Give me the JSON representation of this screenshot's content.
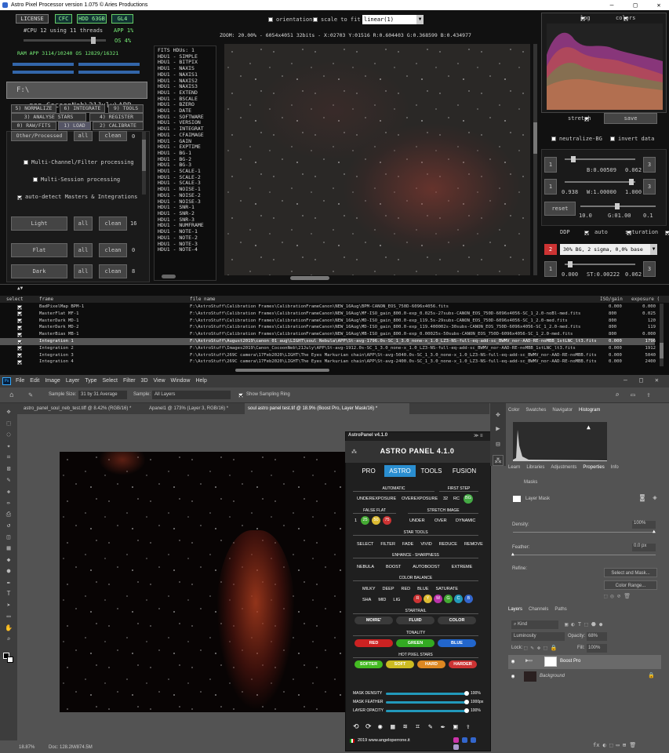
{
  "app": {
    "title": "Astro Pixel Processor version 1.075 © Aries Productions",
    "license": "LICENSE",
    "cfc": "CFC",
    "hdd": "HDD 63GB",
    "gl": "GL4",
    "cpu": "#CPU 12  using 11 threads",
    "app_pct": "APP 1%",
    "os_pct": "OS 4%",
    "ram": "RAM  APP 3114/10240   OS 12829/16321",
    "path": "F:\\ ...non_CocoonNeb\\21July\\APP",
    "tabs": [
      "5) NORMALIZE",
      "6) INTEGRATE",
      "9) TOOLS",
      "3) ANALYSE STARS",
      "4) REGISTER",
      "0) RAW/FITS",
      "1) LOAD",
      "2) CALIBRATE"
    ],
    "other": "Other/Processed",
    "all": "all",
    "clean": "clean",
    "other_count": "0",
    "multichannel": "Multi-Channel/Filter processing",
    "multisession": "Multi-Session processing",
    "autodetect": "auto-detect Masters & Integrations",
    "frames": [
      {
        "label": "Light",
        "count": "16"
      },
      {
        "label": "Flat",
        "count": "0"
      },
      {
        "label": "Dark",
        "count": "8"
      }
    ],
    "hdus": [
      "FITS HDUs: 1",
      "HDU1 - SIMPLE",
      "HDU1 - BITPIX",
      "HDU1 - NAXIS",
      "HDU1 - NAXIS1",
      "HDU1 - NAXIS2",
      "HDU1 - NAXIS3",
      "HDU1 - EXTEND",
      "HDU1 - BSCALE",
      "HDU1 - BZERO",
      "HDU1 - DATE",
      "HDU1 - SOFTWARE",
      "HDU1 - VERSION",
      "HDU1 - INTEGRAT",
      "HDU1 - CFAIMAGE",
      "HDU1 - GAIN",
      "HDU1 - EXPTIME",
      "HDU1 - BG-1",
      "HDU1 - BG-2",
      "HDU1 - BG-3",
      "HDU1 - SCALE-1",
      "HDU1 - SCALE-2",
      "HDU1 - SCALE-3",
      "HDU1 - NOISE-1",
      "HDU1 - NOISE-2",
      "HDU1 - NOISE-3",
      "HDU1 - SNR-1",
      "HDU1 - SNR-2",
      "HDU1 - SNR-3",
      "HDU1 - NUMFRAME",
      "HDU1 - NOTE-1",
      "HDU1 - NOTE-2",
      "HDU1 - NOTE-3",
      "HDU1 - NOTE-4"
    ],
    "orientation": "orientation",
    "scale": "scale to fit",
    "scale_mode": "linear(1)",
    "zoom": "ZOOM: 20.00% - 6054x4051 32bits - X:02703 Y:01516 R:0.604403 G:0.368599 B:0.434977",
    "log": "log",
    "colors": "colors",
    "stretch": "stretch",
    "save": "save",
    "neutralize": "neutralize-BG",
    "invert": "invert data",
    "b_val": "B:0.00509",
    "b_max": "0.062",
    "w_min": "0.938",
    "w_val": "W:1.00000",
    "w_max": "1.000",
    "reset": "reset",
    "r10": "10.0",
    "g100": "G:01.00",
    "g01": "0.1",
    "ddp": "DDP",
    "auto": "auto",
    "saturation": "saturation",
    "preset": "30% BG, 2 sigma, 0,0% base",
    "st_min": "0.000",
    "st_val": "ST:0.00222",
    "st_max": "0.062",
    "btn1": "1",
    "btn3": "3",
    "btn2": "2",
    "table_headers": [
      "select",
      "frame",
      "file name",
      "ISO/gain",
      "exposure ("
    ],
    "table_rows": [
      {
        "frame": "BadPixelMap  BPM-1",
        "file": "F:\\AstroStuff\\Calibration Frames\\CalibrationFrameCanon\\NEW_16Aug\\BPM-CANON_EOS_750D-6096x4056.fits",
        "iso": "0.000",
        "exp": "0.000"
      },
      {
        "frame": "MasterFlat  MF-1",
        "file": "F:\\AstroStuff\\Calibration Frames\\CalibrationFrameCanon\\NEW_16Aug\\MF-ISO_gain_800.0-exp_0.025s-27subs-CANON_EOS_750D-6096x4056-SC_1_2.0-noBl-med.fits",
        "iso": "800",
        "exp": "0.025"
      },
      {
        "frame": "MasterDark  MD-1",
        "file": "F:\\AstroStuff\\Calibration Frames\\CalibrationFrameCanon\\NEW_16Aug\\MD-ISO_gain_800.0-exp_119.5s-29subs-CANON_EOS_750D-6096x4056-SC_1_2.0-med.fits",
        "iso": "800",
        "exp": "120"
      },
      {
        "frame": "MasterDark  MD-2",
        "file": "F:\\AstroStuff\\Calibration Frames\\CalibrationFrameCanon\\NEW_16Aug\\MD-ISO_gain_800.0-exp_119.400002s-30subs-CANON_EOS_750D-6096x4056-SC_1_2.0-med.fits",
        "iso": "800",
        "exp": "119"
      },
      {
        "frame": "MasterBias  MB-1",
        "file": "F:\\AstroStuff\\Calibration Frames\\CalibrationFrameCanon\\NEW_16Aug\\MB-ISO_gain_800.0-exp_0.00025s-50subs-CANON_EOS_750D-6096x4056-SC_1_2.0-med.fits",
        "iso": "800",
        "exp": "0.000"
      },
      {
        "frame": "Integration 1",
        "file": "F:\\AstroStuff\\August2019\\canon 01 aug\\LIGHT\\soul Nebula\\APP\\St-avg-1796.0s-SC_1_3.0_none-x_1.0_LZ3-NS-full-eq-add-sc_BWMV_nor-AAD-RE-noMBB_1stLNC_lt3.fits",
        "iso": "0.000",
        "exp": "1796"
      },
      {
        "frame": "Integration 2",
        "file": "F:\\AstroStuff\\Images2019\\Canon_CocoonNeb\\21July\\APP\\St-avg-1912.0s-SC_1_3.0_none-x_1.0_LZ3-NS-full-eq-add-sc_BWMV_nor-AAD-RE-noMBB_1stLNC_lt3.fits",
        "iso": "0.000",
        "exp": "1912"
      },
      {
        "frame": "Integration 3",
        "file": "F:\\AstroStuff\\269C camera\\17Feb2020\\LIGHT\\The Eyes Markurian chain\\APP\\St-avg-5040.0s-SC_1_3.0_none-x_1.0_LZ3-NS-full-eq-add-sc_BWMV_nor-AAD-RE-noMBB.fits",
        "iso": "0.000",
        "exp": "5040"
      },
      {
        "frame": "Integration 4",
        "file": "F:\\AstroStuff\\269C camera\\17Feb2020\\LIGHT\\The Eyes Markurian chain\\APP\\St-avg-2400.0s-SC_1_3.0_none-x_1.0_LZ3-NS-full-eq-add-sc_BWMV_nor-AAD-RE-noMBB.fits",
        "iso": "0.000",
        "exp": "2400"
      }
    ]
  },
  "ps": {
    "menu": [
      "File",
      "Edit",
      "Image",
      "Layer",
      "Type",
      "Select",
      "Filter",
      "3D",
      "View",
      "Window",
      "Help"
    ],
    "sample_size_label": "Sample Size:",
    "sample_size": "31 by 31 Average",
    "sample_label": "Sample:",
    "sample": "All Layers",
    "show_ring": "Show Sampling Ring",
    "doc_tabs": [
      "astro_panel_soul_neb_test.tiff @ 8.42% (RGB/16) *",
      "Apanel1 @ 173% (Layer 3, RGB/16) *",
      "soul astro panel test.tif @ 18.9% (Boost Pro, Layer Mask/16) *"
    ],
    "status_zoom": "18.87%",
    "status_doc": "Doc: 128.2M/874.5M",
    "panel_tabs1": [
      "Color",
      "Swatches",
      "Navigator",
      "Histogram"
    ],
    "panel_tabs2": [
      "Learn",
      "Libraries",
      "Adjustments",
      "Properties",
      "Info"
    ],
    "masks": "Masks",
    "layer_mask": "Layer Mask",
    "density_label": "Density:",
    "density": "100%",
    "feather_label": "Feather:",
    "feather": "0.0 px",
    "refine": "Refine:",
    "select_mask": "Select and Mask...",
    "color_range": "Color Range...",
    "layer_tabs": [
      "Layers",
      "Channels",
      "Paths"
    ],
    "kind": "Kind",
    "blend": "Luminosity",
    "opacity_label": "Opacity:",
    "opacity": "68%",
    "lock": "Lock:",
    "fill_label": "Fill:",
    "fill": "100%",
    "layers": [
      "Boost Pro",
      "Background"
    ]
  },
  "astro": {
    "header": "AstroPanel v4.1.0",
    "title": "ASTRO PANEL 4.1.0",
    "tabs": [
      "PRO",
      "ASTRO",
      "TOOLS",
      "FUSION"
    ],
    "automatic": "AUTOMATIC",
    "firststep": "FIRST STEP",
    "under": "UNDEREXPOSURE",
    "over": "OVEREXPOSURE",
    "n32": "32",
    "rc": "RC",
    "bg": "BG",
    "falseflat": "FALSE FLAT",
    "stretch": "STRETCH IMAGE",
    "ff1": "1",
    "ff25": "25",
    "ff50": "50",
    "ff75": "75",
    "st_under": "UNDER",
    "st_over": "OVER",
    "st_dyn": "DYNAMIC",
    "startools": "STAR TOOLS",
    "tools": [
      "SELECT",
      "FILTER",
      "FADE",
      "VIVID",
      "REDUCE",
      "REMOVE"
    ],
    "enhance": "ENHANCE - SHARPNESS",
    "enh": [
      "NEBULA",
      "BOOST",
      "AUTOBOOST",
      "EXTREME"
    ],
    "colorbal": "COLOR BALANCE",
    "cb1": [
      "MILKY",
      "DEEP",
      "RED",
      "BLUE",
      "SATURATE"
    ],
    "cb2": [
      "SHA",
      "MID",
      "LIG"
    ],
    "cbdots": [
      "R",
      "Y",
      "M",
      "G",
      "C",
      "B"
    ],
    "startrail": "STARTRAIL",
    "st": [
      "MOIRE'",
      "FLUID",
      "COLOR"
    ],
    "tonality": "TONALITY",
    "ton": [
      "RED",
      "GREEN",
      "BLUE"
    ],
    "hotpixel": "HOT PIXEL STARS",
    "hp": [
      "SOFTER",
      "SOFT",
      "HARD",
      "HARDER"
    ],
    "sliders": [
      {
        "label": "MASK DENSITY",
        "value": "100%"
      },
      {
        "label": "MASK FEATHER",
        "value": "1000px"
      },
      {
        "label": "LAYER OPACITY",
        "value": "100%"
      }
    ],
    "footer": "2019 www.angeloperrone.it"
  }
}
